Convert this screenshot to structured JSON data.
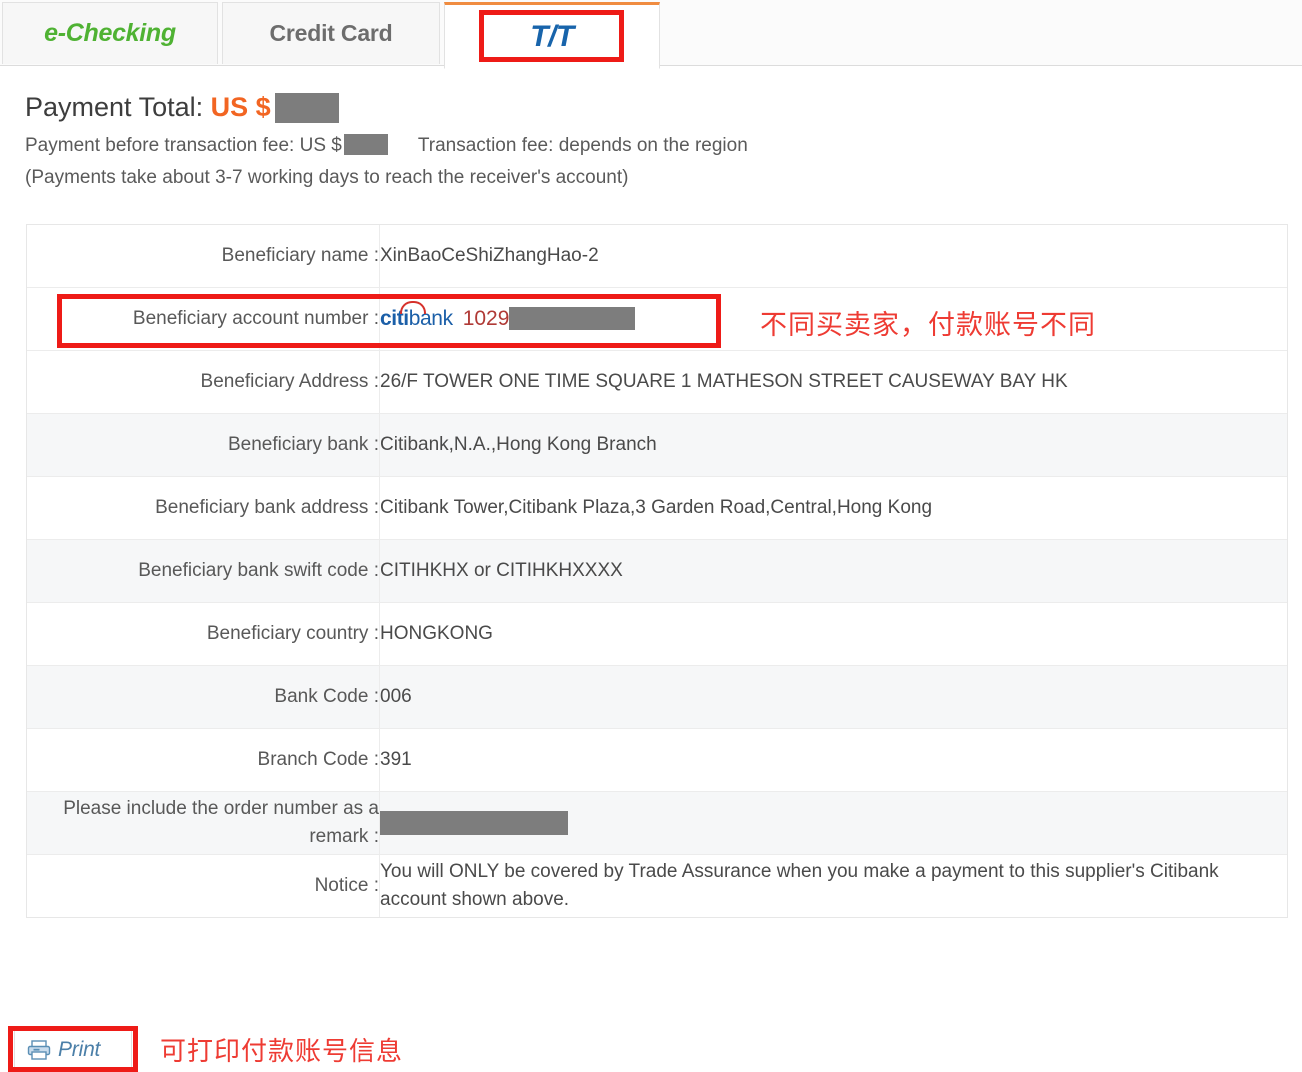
{
  "tabs": [
    {
      "id": "e-checking",
      "label": "e-Checking",
      "active": false
    },
    {
      "id": "credit-card",
      "label": "Credit Card",
      "active": false
    },
    {
      "id": "tt",
      "label": "T/T",
      "active": true
    }
  ],
  "header": {
    "payment_total_label": "Payment Total:",
    "currency": "US $",
    "payment_total_value": "",
    "before_fee_label": "Payment before transaction fee:",
    "before_fee_currency": "US $",
    "before_fee_value": "",
    "transaction_fee_label": "Transaction fee:",
    "transaction_fee_value": "depends on the region",
    "working_days_note": "(Payments take about 3-7 working days to reach the receiver's account)"
  },
  "table": {
    "rows": [
      {
        "label": "Beneficiary name :",
        "value": "XinBaoCeShiZhangHao-2",
        "type": "text",
        "shade": "white"
      },
      {
        "label": "Beneficiary account number :",
        "value": "1029",
        "bank_logo": "citibank",
        "type": "account",
        "shade": "white"
      },
      {
        "label": "Beneficiary Address :",
        "value": "26/F TOWER ONE TIME SQUARE 1 MATHESON STREET CAUSEWAY BAY HK",
        "type": "text",
        "shade": "white"
      },
      {
        "label": "Beneficiary bank :",
        "value": "Citibank,N.A.,Hong Kong Branch",
        "type": "text",
        "shade": "gray"
      },
      {
        "label": "Beneficiary bank address :",
        "value": "Citibank Tower,Citibank Plaza,3 Garden Road,Central,Hong Kong",
        "type": "text",
        "shade": "white"
      },
      {
        "label": "Beneficiary bank swift code :",
        "value": "CITIHKHX or CITIHKHXXXX",
        "type": "text",
        "shade": "gray"
      },
      {
        "label": "Beneficiary country :",
        "value": "HONGKONG",
        "type": "text",
        "shade": "white"
      },
      {
        "label": "Bank Code :",
        "value": "006",
        "type": "text",
        "shade": "gray"
      },
      {
        "label": "Branch Code :",
        "value": "391",
        "type": "text",
        "shade": "white"
      },
      {
        "label": "Please include the order number as a remark :",
        "value": "",
        "type": "masked",
        "shade": "gray"
      },
      {
        "label": "Notice :",
        "value": "You will ONLY be covered by Trade Assurance when you make a payment to this supplier's Citibank account shown above.",
        "type": "text",
        "shade": "white"
      }
    ]
  },
  "annotations": {
    "account_note": "不同买卖家，付款账号不同",
    "print_note": "可打印付款账号信息",
    "highlight_color": "#ee1b17"
  },
  "print_button": {
    "label": "Print",
    "icon": "printer-icon"
  },
  "colors": {
    "accent_orange": "#f26522",
    "tab_active_border": "#f08c40",
    "echecking_green": "#4fb233",
    "tt_blue": "#1864ab",
    "citi_blue": "#1b5fa8",
    "citi_red": "#d6312b",
    "annotation_red": "#ee3b33",
    "mask_gray": "#7d7d7d"
  }
}
